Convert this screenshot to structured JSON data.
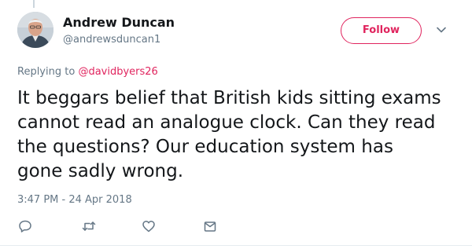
{
  "author": {
    "display_name": "Andrew Duncan",
    "handle": "@andrewsduncan1"
  },
  "follow": {
    "label": "Follow"
  },
  "reply_context": {
    "prefix": "Replying to",
    "handle": "@davidbyers26"
  },
  "tweet": {
    "text": "It beggars belief that British kids sitting exams cannot read an analogue clock. Can they read the questions? Our education system has gone sadly wrong.",
    "timestamp": "3:47 PM - 24 Apr 2018"
  },
  "icons": {
    "menu": "chevron-down-icon",
    "reply": "reply-icon",
    "retweet": "retweet-icon",
    "like": "heart-icon",
    "message": "direct-message-icon"
  },
  "colors": {
    "accent": "#e0245e",
    "text": "#14171a",
    "muted": "#657786",
    "icon": "#657786"
  }
}
